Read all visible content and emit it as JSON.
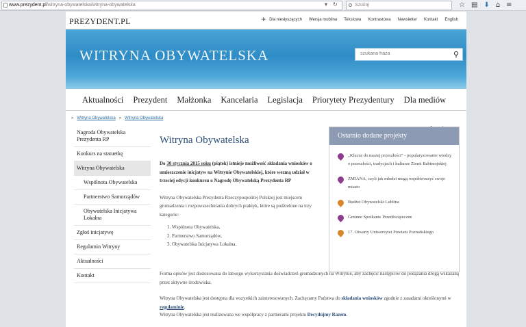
{
  "browser": {
    "url_host": "www.prezydent.pl",
    "url_path": "/witryna-obywatelska/witryna-obywatelska",
    "search_placeholder": "Szukaj"
  },
  "site": {
    "logo": "PREZYDENT.PL",
    "top_links": [
      "Dla niesłyszących",
      "Wersja mobilna",
      "Tekstowa",
      "Kontrastowa",
      "Newsletter",
      "Kontakt",
      "English"
    ],
    "banner_title": "WITRYNA OBYWATELSKA",
    "search_placeholder": "szukana fraza",
    "main_nav": [
      "Aktualności",
      "Prezydent",
      "Małżonka",
      "Kancelaria",
      "Legislacja",
      "Priorytety Prezydentury",
      "Dla mediów"
    ]
  },
  "breadcrumb": [
    "Witryna Obywatelska",
    "Witryna Obywatelska"
  ],
  "breadcrumb_sep": "»",
  "sidebar": {
    "items": [
      "Nagroda Obywatelska Prezydenta RP",
      "Konkurs na statuetkę",
      "Witryna Obywatelska",
      "Wspólnota Obywatelska",
      "Partnerstwo Samorządów",
      "Obywatelska Inicjatywa Lokalna",
      "Zgłoś inicjatywę",
      "Regulamin Witryny",
      "Aktualności",
      "Kontakt"
    ]
  },
  "tools": {
    "a_small": "A",
    "a_medium": "A",
    "a_large": "A"
  },
  "content": {
    "title": "Witryna Obywatelska",
    "lead_pre": "Do ",
    "lead_date": "30 stycznia 2015 roku",
    "lead_post": " (piątek) istnieje możliwość składania wniosków o umieszczenie inicjatyw na Witrynie Obywatelskiej, które wezmą udział w trzeciej edycji konkursu o Nagrodę Obywatelską Prezydenta RP",
    "para1": "Witryna Obywatelska Prezydenta Rzeczypospolitej Polskiej jest miejscem gromadzenia i rozpowszechniania dobrych praktyk, które są podzielone na trzy kategorie:",
    "categories": [
      "Wspólnota Obywatelska,",
      "Partnerstwo Samorządów,",
      "Obywatelska Inicjatywa Lokalna."
    ],
    "para2": "Forma opisów jest dostosowana do łatwego wykorzystania doświadczeń gromadzonych na Witrynie, aby zachęcić następców do podążania drogą wskazaną przez aktywne środowiska.",
    "para3_pre": "Witryna Obywatelska jest dostępna dla wszystkich zainteresowanych. Zachęcamy Państwa do ",
    "para3_link1": "składania wniosków",
    "para3_mid": " zgodnie z zasadami określonymi w ",
    "para3_link2": "regulaminie",
    "para3_end": ".",
    "para4_pre": "Witryna Obywatelska jest realizowana we współpracy z partnerami projektu ",
    "para4_link": "Decydujmy Razem",
    "para4_end": "."
  },
  "recent": {
    "heading": "Ostatnio dodane projekty",
    "items": [
      {
        "text": "„Klucze do naszej przeszłości” - popularyzowanie wiedzy o przeszłości, tradycjach i kulturze Ziemi Babimojskiej",
        "color": "#8e3a8e"
      },
      {
        "text": "ZMIANA, czyli jak młodzi mogą współtworzyć swoje miasto",
        "color": "#8e3a8e"
      },
      {
        "text": "Budżet Obywatelski Lublina",
        "color": "#d9862a"
      },
      {
        "text": "Gminne Spotkanie Przedświąteczne",
        "color": "#8e3a8e"
      },
      {
        "text": "17. Otwarty Uniwersytet Powiatu Poznańskiego",
        "color": "#d9862a"
      }
    ]
  }
}
